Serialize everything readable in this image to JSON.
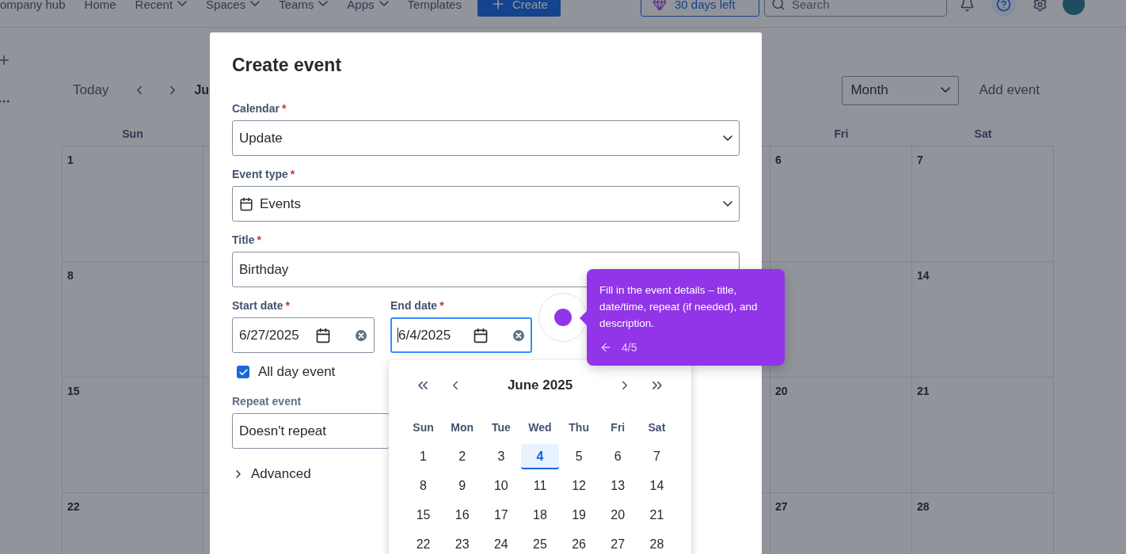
{
  "top_nav": {
    "items": [
      {
        "label": "ompany hub",
        "dropdown": false
      },
      {
        "label": "Home",
        "dropdown": false
      },
      {
        "label": "Recent",
        "dropdown": true
      },
      {
        "label": "Spaces",
        "dropdown": true
      },
      {
        "label": "Teams",
        "dropdown": true
      },
      {
        "label": "Apps",
        "dropdown": true
      },
      {
        "label": "Templates",
        "dropdown": false
      }
    ],
    "create_button": "Create",
    "trial_button": "30 days left",
    "search": {
      "placeholder": "Search"
    }
  },
  "calendar_toolbar": {
    "today_button": "Today",
    "month_title": "Ju",
    "view_select": "Month",
    "add_event": "Add event"
  },
  "calendar": {
    "weekdays": {
      "sun": "Sun",
      "fri": "Fri",
      "sat": "Sat"
    },
    "weeks": [
      {
        "sun": "1",
        "fri": "6",
        "sat": "7"
      },
      {
        "sun": "8",
        "sat": "14"
      },
      {
        "sun": "15",
        "fri": "20",
        "sat": "21"
      },
      {
        "sun": "22",
        "fri": "27",
        "sat": "28"
      }
    ]
  },
  "dialog": {
    "title": "Create event",
    "calendar": {
      "label": "Calendar",
      "required_mark": "*",
      "value": "Update"
    },
    "event_type": {
      "label": "Event type",
      "required_mark": "*",
      "value": "Events"
    },
    "title_field": {
      "label": "Title",
      "required_mark": "*",
      "value": "Birthday"
    },
    "start_date": {
      "label": "Start date",
      "required_mark": "*",
      "value": "6/27/2025",
      "focused": false
    },
    "end_date": {
      "label": "End date",
      "required_mark": "*",
      "value": "6/4/2025",
      "focused": true
    },
    "all_day": {
      "label": "All day event",
      "checked": true
    },
    "repeat": {
      "label": "Repeat event",
      "value": "Doesn't repeat"
    },
    "advanced": {
      "label": "Advanced",
      "expanded": false
    }
  },
  "date_picker": {
    "month": "June 2025",
    "weekdays": [
      "Sun",
      "Mon",
      "Tue",
      "Wed",
      "Thu",
      "Fri",
      "Sat"
    ],
    "days": [
      {
        "label": "1",
        "selected": false
      },
      {
        "label": "2",
        "selected": false
      },
      {
        "label": "3",
        "selected": false
      },
      {
        "label": "4",
        "selected": true
      },
      {
        "label": "5",
        "selected": false
      },
      {
        "label": "6",
        "selected": false
      },
      {
        "label": "7",
        "selected": false
      },
      {
        "label": "8",
        "selected": false
      },
      {
        "label": "9",
        "selected": false
      },
      {
        "label": "10",
        "selected": false
      },
      {
        "label": "11",
        "selected": false
      },
      {
        "label": "12",
        "selected": false
      },
      {
        "label": "13",
        "selected": false
      },
      {
        "label": "14",
        "selected": false
      },
      {
        "label": "15",
        "selected": false
      },
      {
        "label": "16",
        "selected": false
      },
      {
        "label": "17",
        "selected": false
      },
      {
        "label": "18",
        "selected": false
      },
      {
        "label": "19",
        "selected": false
      },
      {
        "label": "20",
        "selected": false
      },
      {
        "label": "21",
        "selected": false
      },
      {
        "label": "22",
        "selected": false
      },
      {
        "label": "23",
        "selected": false
      },
      {
        "label": "24",
        "selected": false
      },
      {
        "label": "25",
        "selected": false
      },
      {
        "label": "26",
        "selected": false
      },
      {
        "label": "27",
        "selected": false
      },
      {
        "label": "28",
        "selected": false
      }
    ]
  },
  "tour_tooltip": {
    "text": "Fill in the event details – title, date/time, repeat (if needed), and description.",
    "step": "4/5"
  }
}
